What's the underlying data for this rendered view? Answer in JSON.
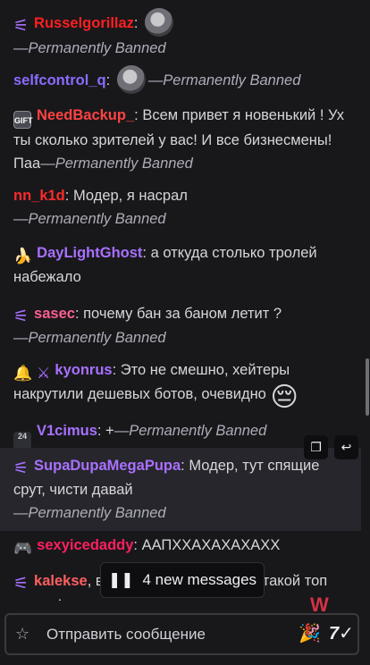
{
  "chat": {
    "messages": [
      {
        "user": "Russelgorillaz",
        "color": "#ff1f1f",
        "text": "",
        "ban": "—Permanently Banned",
        "badge": "ctrl-icon"
      },
      {
        "user": "selfcontrol_q",
        "color": "#8a6cff",
        "text": "",
        "ban": "—Permanently Banned"
      },
      {
        "user": "NeedBackup_",
        "color": "#ff4242",
        "text": "Всем привет я новенький ! Ух ты сколько зрителей у вас! И все бизнесмены! Паа",
        "ban": "—Permanently Banned",
        "badge": "sub-gift-icon"
      },
      {
        "user": "nn_k1d",
        "color": "#ff2a2a",
        "text": "Модер, я насрал",
        "ban": "—Permanently Banned"
      },
      {
        "user": "DayLightGhost",
        "color": "#a970ff",
        "text": "а откуда столько тролей набежало",
        "ban": "",
        "badge": "banana-icon"
      },
      {
        "user": "sasec",
        "color": "#ff5f8f",
        "text": "почему бан за баном летит ?",
        "ban": "—Permanently Banned",
        "badge": "ctrl-icon"
      },
      {
        "user": "kyonrus",
        "color": "#a970ff",
        "text": "Это не смешно, хейтеры накрутили дешевых ботов, очевидно",
        "ban": "",
        "badge": "bell-icon"
      },
      {
        "user": "V1cimus",
        "color": "#a970ff",
        "text": "+",
        "ban": "—Permanently Banned",
        "badge_text": "24"
      },
      {
        "user": "SupaDupaMegaPupa",
        "color": "#a970ff",
        "text": "Модер, тут спящие срут, чисти давай",
        "ban": "—Permanently Banned",
        "badge": "ctrl-icon"
      },
      {
        "user": "sexyicedaddy",
        "color": "#ff1f5f",
        "text": "ААПХХАХАХАХАХХ",
        "ban": "",
        "badge": "gamepad-icon"
      },
      {
        "user": "kalekse",
        "color": "#ff5f5f",
        "text": ", вау! Всем расскажу про такой топ контик!",
        "ban": "",
        "badge": "ctrl-icon"
      }
    ],
    "emoji_pensive": "😔",
    "gift_badge_text": "GIFT"
  },
  "new_messages": {
    "icon": "pause-icon",
    "label": "4 new messages"
  },
  "input": {
    "placeholder": "Отправить сообщение"
  },
  "w_logo": "W",
  "colors": {
    "background": "#18181b",
    "accent": "#a970ff"
  }
}
